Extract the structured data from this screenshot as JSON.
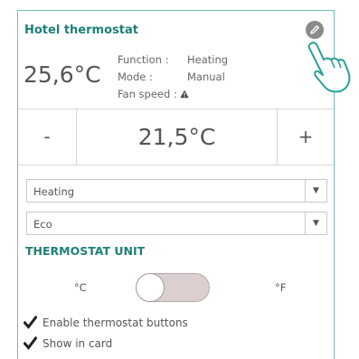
{
  "widget": {
    "title": "Hotel thermostat",
    "current_temp": "25,6°C",
    "info_labels": [
      "Function :",
      "Mode :",
      "Fan speed :"
    ],
    "info_values": [
      "Heating",
      "Manual"
    ]
  },
  "setpoint": {
    "minus_label": "-",
    "value": "21,5°C",
    "plus_label": "+"
  },
  "selects": {
    "function_value": "Heating",
    "mode_value": "Eco"
  },
  "unit": {
    "title": "THERMOSTAT UNIT",
    "celsius_label": "°C",
    "fahrenheit_label": "°F",
    "selected": "°C"
  },
  "options": [
    {
      "label": "Enable thermostat buttons",
      "checked": true
    },
    {
      "label": "Show in card",
      "checked": true
    }
  ],
  "icons": {
    "edit": "pencil-icon",
    "fan_warning": "warning-triangle-icon",
    "pointer": "hand-pointer-icon",
    "dropdown": "caret-down-icon",
    "check": "checkmark-icon"
  },
  "colors": {
    "accent": "#1e8078",
    "panel_border": "#6cc1b8",
    "toggle_track": "#dccfd0"
  }
}
